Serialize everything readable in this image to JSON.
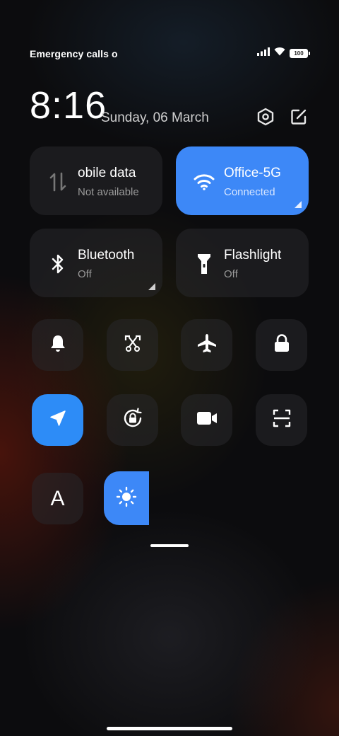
{
  "status_bar": {
    "carrier_text": "Emergency calls o",
    "battery_level": "100",
    "signal_icon": "cellular-signal-icon",
    "wifi_icon": "wifi-icon",
    "battery_icon": "battery-icon"
  },
  "header": {
    "time": "8:16",
    "date": "Sunday, 06 March",
    "settings_icon": "settings-hex-icon",
    "edit_icon": "edit-icon"
  },
  "big_tiles": [
    {
      "id": "mobile-data",
      "title": "obile data",
      "subtitle": "Not available",
      "icon": "mobile-data-arrows-icon",
      "active": false
    },
    {
      "id": "wifi",
      "title": "Office-5G",
      "subtitle": "Connected",
      "icon": "wifi-icon",
      "active": true
    },
    {
      "id": "bluetooth",
      "title": "Bluetooth",
      "subtitle": "Off",
      "icon": "bluetooth-icon",
      "active": false
    },
    {
      "id": "flashlight",
      "title": "Flashlight",
      "subtitle": "Off",
      "icon": "flashlight-icon",
      "active": false
    }
  ],
  "small_toggles": [
    {
      "id": "sound",
      "icon": "bell-icon",
      "active": false
    },
    {
      "id": "screenshot",
      "icon": "scissors-screenshot-icon",
      "active": false
    },
    {
      "id": "airplane",
      "icon": "airplane-icon",
      "active": false
    },
    {
      "id": "lock",
      "icon": "lock-icon",
      "active": false
    },
    {
      "id": "location",
      "icon": "location-arrow-icon",
      "active": true
    },
    {
      "id": "auto-rotate",
      "icon": "rotation-lock-icon",
      "active": false
    },
    {
      "id": "screen-record",
      "icon": "video-camera-icon",
      "active": false
    },
    {
      "id": "scanner",
      "icon": "scan-icon",
      "active": false
    },
    {
      "id": "reading-mode",
      "icon": "font-a-icon",
      "label": "A",
      "active": false
    }
  ],
  "brightness": {
    "icon": "sun-icon",
    "level_fraction": 0.07
  },
  "colors": {
    "accent": "#3d88f7",
    "tile_bg": "#28282c",
    "background": "#0c0c0e"
  }
}
